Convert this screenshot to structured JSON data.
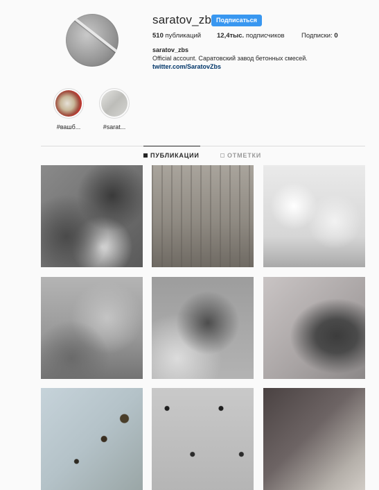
{
  "profile": {
    "username": "saratov_zbs",
    "follow_label": "Подписаться",
    "stats": {
      "posts_count": "510",
      "posts_label": "публикаций",
      "followers_count": "12,4тыс.",
      "followers_label": "подписчиков",
      "following_label": "Подписки:",
      "following_count": "0"
    },
    "bio": {
      "name": "saratov_zbs",
      "text": "Official account. Саратовский завод бетонных смесей.",
      "link": "twitter.com/SaratovZbs"
    }
  },
  "highlights": [
    {
      "label": "#вашб..."
    },
    {
      "label": "#sarat..."
    }
  ],
  "tabs": [
    {
      "label": "ПУБЛИКАЦИИ",
      "active": true
    },
    {
      "label": "ОТМЕТКИ",
      "active": false
    }
  ],
  "colors": {
    "accent": "#3897f0",
    "link": "#003569",
    "background": "#fafafa",
    "divider": "#dbdbdb"
  },
  "posts": [
    {
      "icon": "concrete-texture-dark"
    },
    {
      "icon": "concrete-texture-streaked"
    },
    {
      "icon": "concrete-texture-bubbly-white"
    },
    {
      "icon": "concrete-texture-grey"
    },
    {
      "icon": "concrete-texture-crumbling"
    },
    {
      "icon": "concrete-texture-dark-stain"
    },
    {
      "icon": "concrete-texture-blue-holes"
    },
    {
      "icon": "concrete-texture-holes"
    },
    {
      "icon": "concrete-texture-dark-gradient"
    }
  ]
}
